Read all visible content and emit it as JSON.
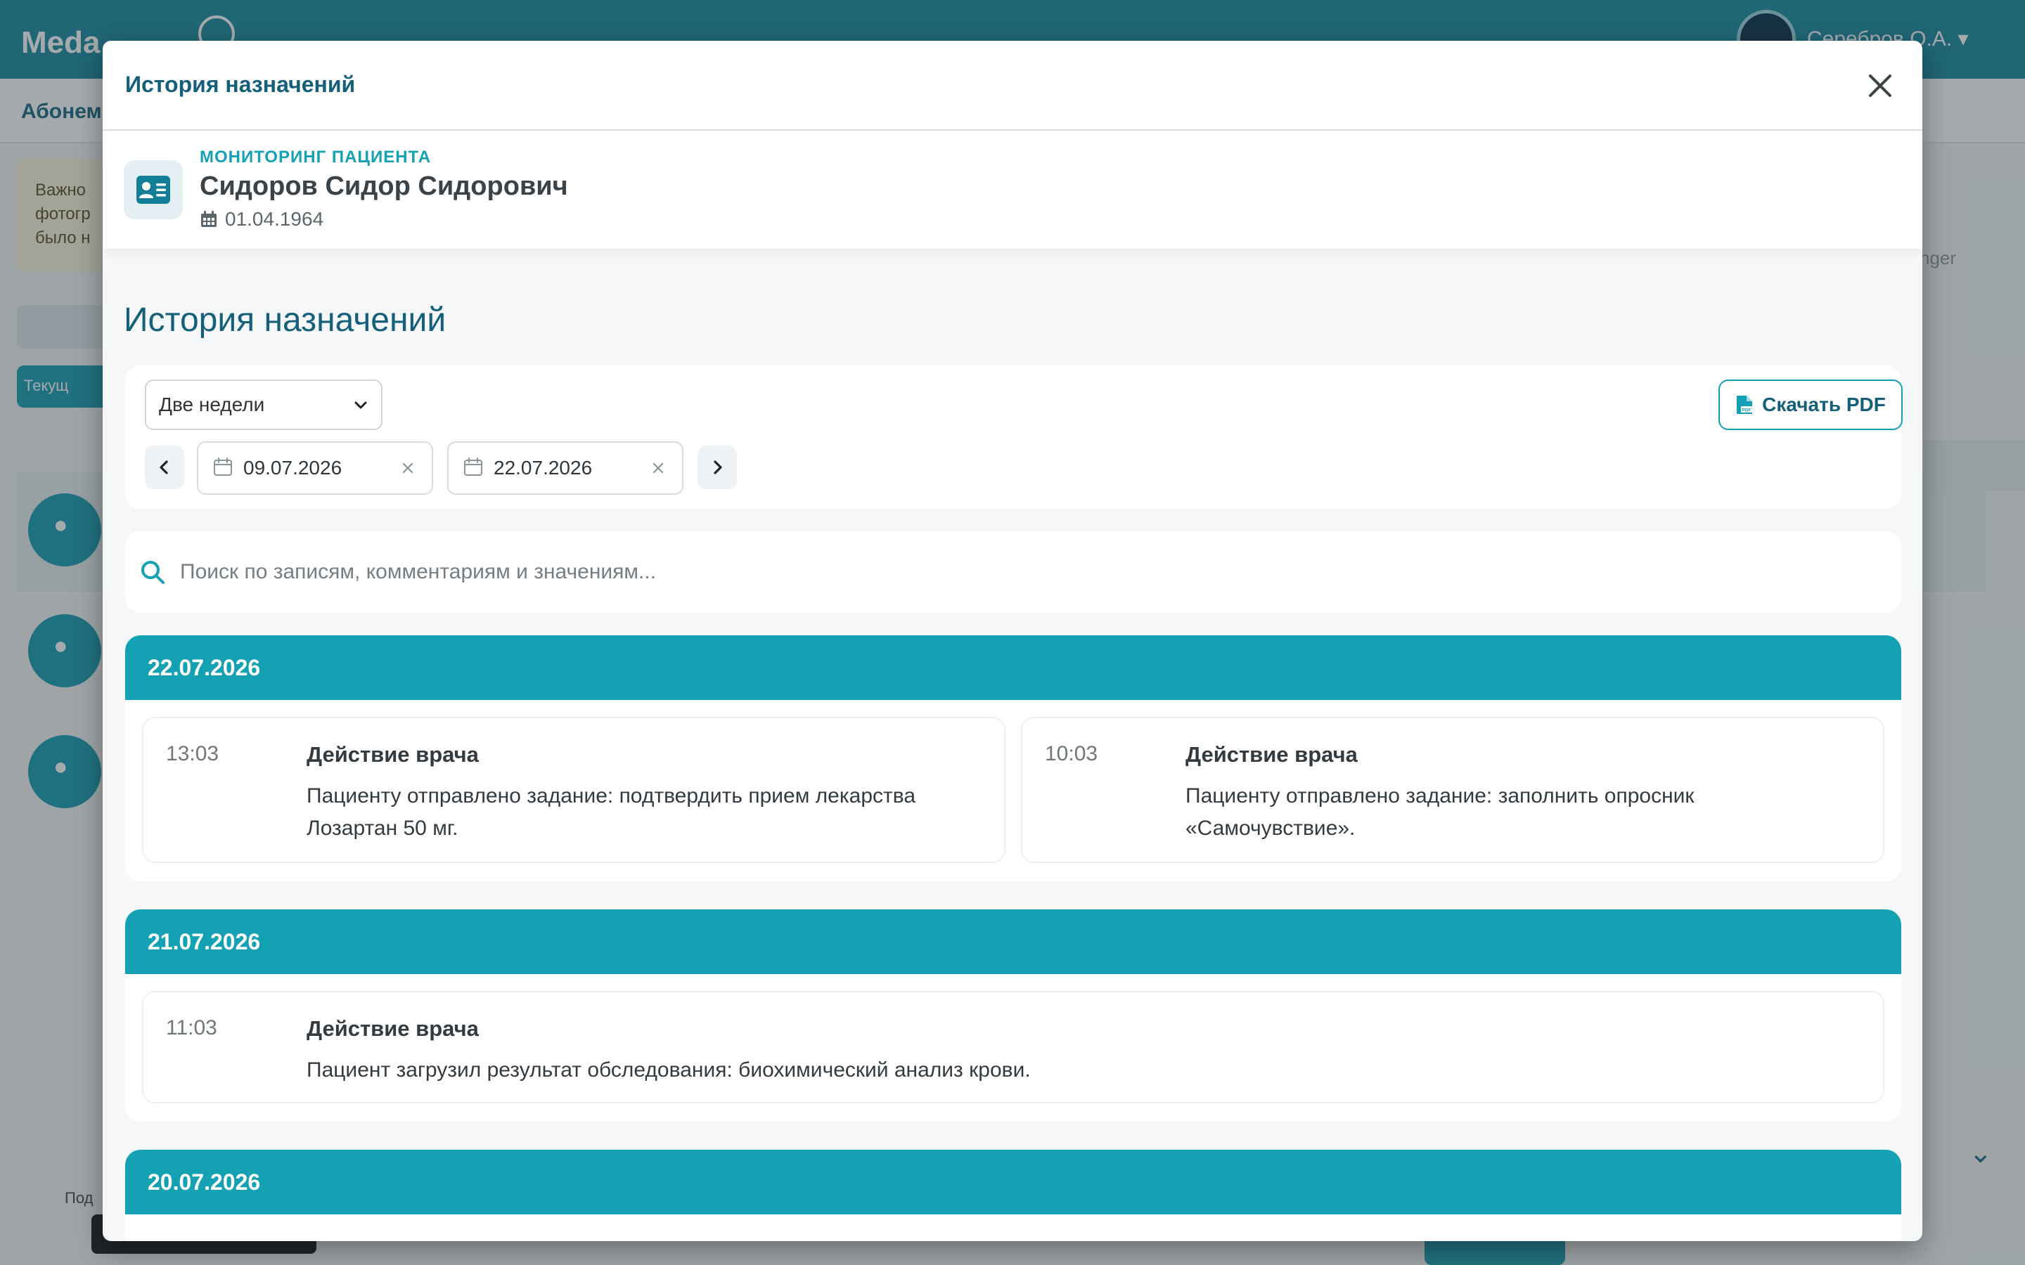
{
  "background": {
    "app_name": "Meda",
    "user_name": "Серебров О.А. ▾",
    "subbar_label": "Абонем",
    "notice_lines": [
      "Важно",
      "фотогр",
      "было н"
    ],
    "tab_label": "Текущ",
    "right_text": "nger",
    "bottom_label": "Под"
  },
  "modal": {
    "title": "История назначений",
    "close_icon": "close-icon"
  },
  "patient": {
    "label": "МОНИТОРИНГ ПАЦИЕНТА",
    "name": "Сидоров Сидор Сидорович",
    "dob": "01.04.1964",
    "icon": "id-card-icon"
  },
  "section_title": "История назначений",
  "filters": {
    "period_value": "Две недели",
    "date_from": "09.07.2026",
    "date_to": "22.07.2026",
    "pdf_label": "Скачать PDF"
  },
  "search": {
    "placeholder": "Поиск по записям, комментариям и значениям..."
  },
  "days": [
    {
      "date": "22.07.2026",
      "entries": [
        {
          "time": "13:03",
          "title": "Действие врача",
          "text": "Пациенту отправлено задание: подтвердить прием лекарства Лозартан 50 мг."
        },
        {
          "time": "10:03",
          "title": "Действие врача",
          "text": "Пациенту отправлено задание: заполнить опросник «Самочувствие»."
        }
      ]
    },
    {
      "date": "21.07.2026",
      "entries": [
        {
          "time": "11:03",
          "title": "Действие врача",
          "text": "Пациент загрузил результат обследования: биохимический анализ крови."
        }
      ]
    },
    {
      "date": "20.07.2026",
      "entries": []
    }
  ],
  "colors": {
    "accent": "#13a1b3",
    "title": "#145f7a",
    "topbar": "#1a8aa0"
  }
}
